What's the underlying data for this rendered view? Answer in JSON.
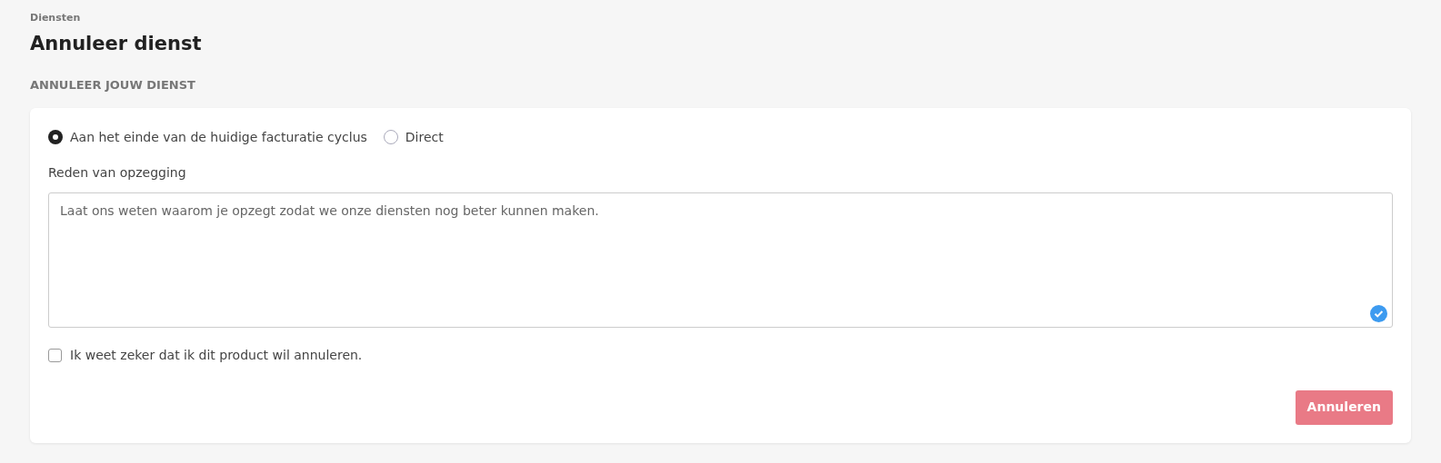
{
  "breadcrumb": "Diensten",
  "title": "Annuleer dienst",
  "section_heading": "ANNULEER JOUW DIENST",
  "cancel_options": [
    {
      "label": "Aan het einde van de huidige facturatie cyclus",
      "selected": true
    },
    {
      "label": "Direct",
      "selected": false
    }
  ],
  "reason": {
    "label": "Reden van opzegging",
    "placeholder": "Laat ons weten waarom je opzegt zodat we onze diensten nog beter kunnen maken."
  },
  "confirm": {
    "label": "Ik weet zeker dat ik dit product wil annuleren.",
    "checked": false
  },
  "submit": {
    "label": "Annuleren",
    "disabled": true
  }
}
